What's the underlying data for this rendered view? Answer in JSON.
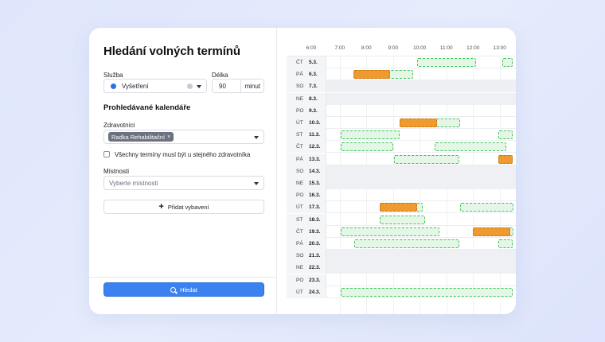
{
  "title": "Hledání volných termínů",
  "service": {
    "label": "Služba",
    "value": "Vyšetření",
    "color": "#2f6fe6"
  },
  "duration": {
    "label": "Délka",
    "value": "90",
    "unit": "minut"
  },
  "calendars_section": "Prohledávané kalendáře",
  "staff": {
    "label": "Zdravotníci",
    "chip": "Radka Rehabilitační",
    "chip_remove": "×"
  },
  "same_staff_checkbox": {
    "label": "Všechny termíny musí být u stejného zdravotníka",
    "checked": false
  },
  "rooms": {
    "label": "Místnosti",
    "placeholder": "Vyberte místnosti"
  },
  "add_equipment": "Přidat vybavení",
  "search_button": "Hledat",
  "calendar": {
    "hours": [
      "6:00",
      "7:00",
      "8:00",
      "9:00",
      "10:00",
      "11:00",
      "12:00",
      "13:00"
    ],
    "colors": {
      "free": "#44c25a",
      "busy": "#ee9a2e"
    },
    "days": [
      {
        "dn": "ČT",
        "date": "5.3.",
        "weekend": false,
        "slots": [
          {
            "t": "free",
            "s": 9.9,
            "e": 12.1
          },
          {
            "t": "free",
            "s": 13.1,
            "e": 13.5
          }
        ]
      },
      {
        "dn": "PÁ",
        "date": "6.3.",
        "weekend": false,
        "slots": [
          {
            "t": "free",
            "s": 7.5,
            "e": 9.75
          },
          {
            "t": "busy",
            "s": 7.5,
            "e": 8.9
          }
        ]
      },
      {
        "dn": "SO",
        "date": "7.3.",
        "weekend": true,
        "slots": []
      },
      {
        "dn": "NE",
        "date": "8.3.",
        "weekend": true,
        "slots": []
      },
      {
        "dn": "PO",
        "date": "9.3.",
        "weekend": false,
        "slots": []
      },
      {
        "dn": "ÚT",
        "date": "10.3.",
        "weekend": false,
        "slots": [
          {
            "t": "free",
            "s": 9.25,
            "e": 11.5
          },
          {
            "t": "busy",
            "s": 9.25,
            "e": 10.65
          }
        ]
      },
      {
        "dn": "ST",
        "date": "11.3.",
        "weekend": false,
        "slots": [
          {
            "t": "free",
            "s": 7.05,
            "e": 9.25
          },
          {
            "t": "free",
            "s": 12.95,
            "e": 13.5
          }
        ]
      },
      {
        "dn": "ČT",
        "date": "12.3.",
        "weekend": false,
        "slots": [
          {
            "t": "free",
            "s": 7.05,
            "e": 9.0
          },
          {
            "t": "free",
            "s": 10.55,
            "e": 13.25
          }
        ]
      },
      {
        "dn": "PÁ",
        "date": "13.3.",
        "weekend": false,
        "slots": [
          {
            "t": "free",
            "s": 9.05,
            "e": 11.5
          },
          {
            "t": "busy",
            "s": 12.95,
            "e": 13.5
          }
        ]
      },
      {
        "dn": "SO",
        "date": "14.3.",
        "weekend": true,
        "slots": []
      },
      {
        "dn": "NE",
        "date": "15.3.",
        "weekend": true,
        "slots": []
      },
      {
        "dn": "PO",
        "date": "16.3.",
        "weekend": false,
        "slots": []
      },
      {
        "dn": "ÚT",
        "date": "17.3.",
        "weekend": false,
        "slots": [
          {
            "t": "free",
            "s": 8.5,
            "e": 10.1
          },
          {
            "t": "busy",
            "s": 8.5,
            "e": 9.9
          },
          {
            "t": "free",
            "s": 11.5,
            "e": 13.5
          }
        ]
      },
      {
        "dn": "ST",
        "date": "18.3.",
        "weekend": false,
        "slots": [
          {
            "t": "free",
            "s": 8.5,
            "e": 10.2
          }
        ]
      },
      {
        "dn": "ČT",
        "date": "19.3.",
        "weekend": false,
        "slots": [
          {
            "t": "free",
            "s": 7.05,
            "e": 10.75
          },
          {
            "t": "free",
            "s": 12.0,
            "e": 13.5
          },
          {
            "t": "busy",
            "s": 12.0,
            "e": 13.4
          }
        ]
      },
      {
        "dn": "PÁ",
        "date": "20.3.",
        "weekend": false,
        "slots": [
          {
            "t": "free",
            "s": 7.55,
            "e": 11.5
          },
          {
            "t": "free",
            "s": 12.95,
            "e": 13.5
          }
        ]
      },
      {
        "dn": "SO",
        "date": "21.3.",
        "weekend": true,
        "slots": []
      },
      {
        "dn": "NE",
        "date": "22.3.",
        "weekend": true,
        "slots": []
      },
      {
        "dn": "PO",
        "date": "23.3.",
        "weekend": false,
        "slots": []
      },
      {
        "dn": "ÚT",
        "date": "24.3.",
        "weekend": false,
        "slots": [
          {
            "t": "free",
            "s": 7.05,
            "e": 13.5
          }
        ]
      }
    ]
  }
}
